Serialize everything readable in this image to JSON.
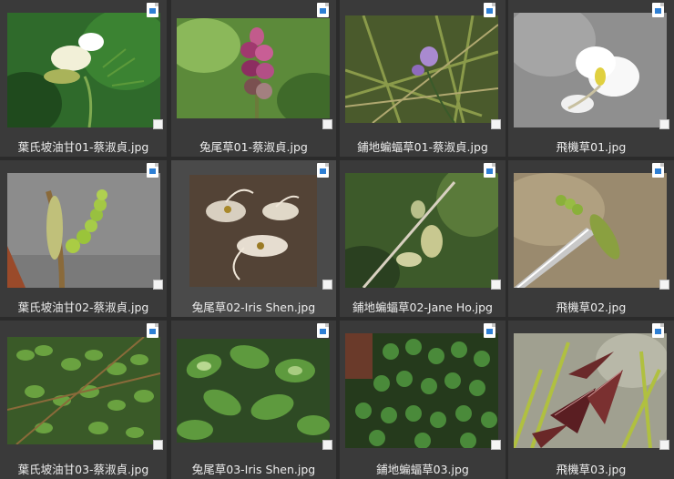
{
  "files": [
    {
      "name": "葉氏坡油甘01-蔡淑貞.jpg",
      "thumb": "white-flower-green"
    },
    {
      "name": "兔尾草01-蔡淑貞.jpg",
      "thumb": "pink-spike"
    },
    {
      "name": "鋪地蝙蝠草01-蔡淑貞.jpg",
      "thumb": "purple-flower-grass"
    },
    {
      "name": "飛機草01.jpg",
      "thumb": "white-flower-gray"
    },
    {
      "name": "葉氏坡油甘02-蔡淑貞.jpg",
      "thumb": "green-pod-gray"
    },
    {
      "name": "兔尾草02-Iris Shen.jpg",
      "thumb": "fluffy-seeds"
    },
    {
      "name": "鋪地蝙蝠草02-Jane Ho.jpg",
      "thumb": "seed-pods-branch"
    },
    {
      "name": "飛機草02.jpg",
      "thumb": "pod-on-tweezers"
    },
    {
      "name": "葉氏坡油甘03-蔡淑貞.jpg",
      "thumb": "pinnate-leaves"
    },
    {
      "name": "兔尾草03-Iris Shen.jpg",
      "thumb": "oval-leaves"
    },
    {
      "name": "鋪地蝙蝠草03.jpg",
      "thumb": "round-leaves"
    },
    {
      "name": "飛機草03.jpg",
      "thumb": "red-striped-leaves"
    }
  ],
  "icons": {
    "file_type": "image-file-icon",
    "select": "checkbox-icon"
  }
}
